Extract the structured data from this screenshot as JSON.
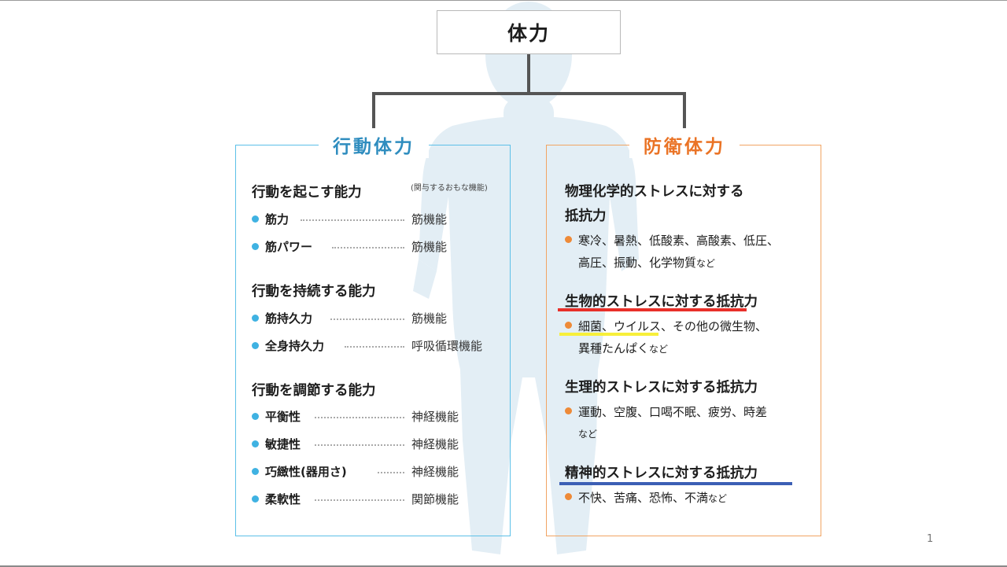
{
  "root": {
    "title": "体力"
  },
  "left": {
    "title": "行動体力",
    "note": "(関与するおもな機能)",
    "groups": [
      {
        "heading": "行動を起こす能力",
        "items": [
          {
            "name": "筋力",
            "func": "筋機能"
          },
          {
            "name": "筋パワー",
            "func": "筋機能"
          }
        ]
      },
      {
        "heading": "行動を持続する能力",
        "items": [
          {
            "name": "筋持久力",
            "func": "筋機能"
          },
          {
            "name": "全身持久力",
            "func": "呼吸循環機能"
          }
        ]
      },
      {
        "heading": "行動を調節する能力",
        "items": [
          {
            "name": "平衡性",
            "func": "神経機能"
          },
          {
            "name": "敏捷性",
            "func": "神経機能"
          },
          {
            "name": "巧緻性(器用さ)",
            "func": "神経機能"
          },
          {
            "name": "柔軟性",
            "func": "関節機能"
          }
        ]
      }
    ]
  },
  "right": {
    "title": "防衛体力",
    "sections": [
      {
        "heading_line1": "物理化学的ストレスに対する",
        "heading_line2": "抵抗力",
        "line1": "寒冷、暑熱、低酸素、高酸素、低圧、",
        "line2": "高圧、振動、化学物質",
        "suffix": "など"
      },
      {
        "heading": "生物的ストレスに対する抵抗力",
        "line1": "細菌、ウイルス、その他の微生物、",
        "line2": "異種たんぱく",
        "suffix": "など"
      },
      {
        "heading": "生理的ストレスに対する抵抗力",
        "line1": "運動、空腹、口喝不眠、疲労、時差",
        "suffix": "など"
      },
      {
        "heading": "精神的ストレスに対する抵抗力",
        "line1": "不快、苦痛、恐怖、不満",
        "suffix": "など"
      }
    ]
  },
  "colors": {
    "left_accent": "#3fb2e2",
    "right_accent": "#ee8a38",
    "underline_red": "#e8302a",
    "underline_yellow": "#f7ef3a",
    "underline_blue": "#3c5fb5"
  },
  "page_number": "1"
}
